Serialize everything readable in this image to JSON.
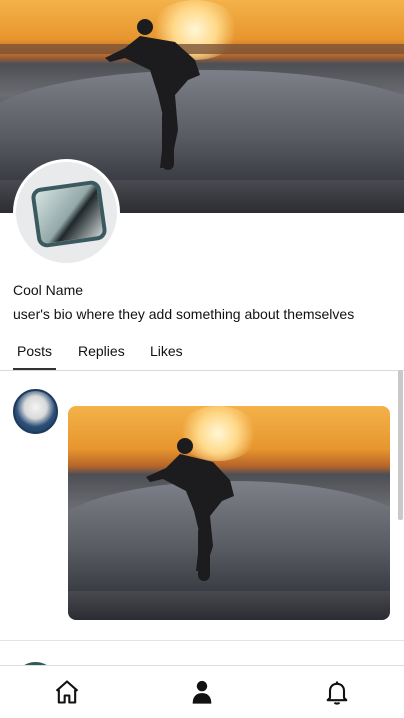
{
  "profile": {
    "name": "Cool Name",
    "bio": "user's bio where they add something about themselves"
  },
  "tabs": [
    {
      "label": "Posts",
      "active": true
    },
    {
      "label": "Replies",
      "active": false
    },
    {
      "label": "Likes",
      "active": false
    }
  ],
  "nav": {
    "icons": [
      "home-icon",
      "profile-icon",
      "bell-icon"
    ]
  },
  "colors": {
    "accent": "#333333",
    "divider": "#d9d9d9"
  }
}
